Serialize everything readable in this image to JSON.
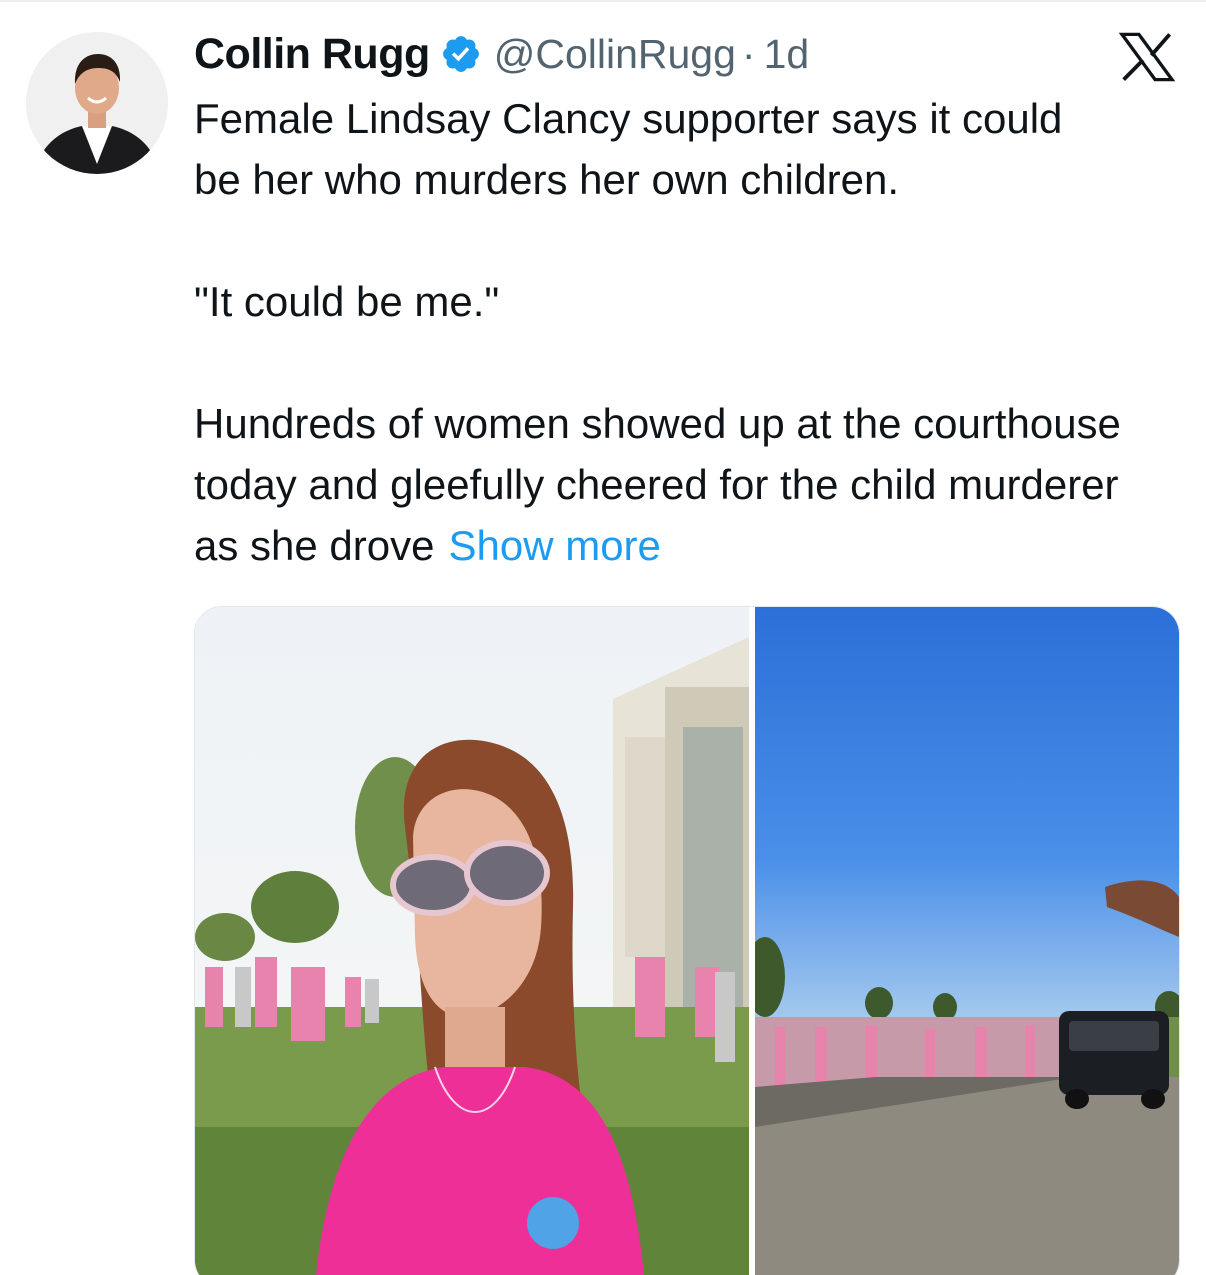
{
  "author": {
    "display_name": "Collin Rugg",
    "handle": "@CollinRugg",
    "separator": "·",
    "time": "1d",
    "verified_color": "#1d9bf0"
  },
  "tweet": {
    "paragraph_1": "Female Lindsay Clancy supporter says it could be her who murders her own children.",
    "paragraph_2": "\"It could be me.\"",
    "paragraph_3": "Hundreds of women showed up at the courthouse today and gleefully cheered for the child murderer as she drove",
    "show_more": "Show more"
  },
  "icons": {
    "verified": "verified-badge-icon",
    "platform": "x-logo-icon"
  },
  "colors": {
    "text": "#0f1419",
    "secondary": "#536471",
    "link": "#1d9bf0",
    "shirt_pink": "#ee2f98",
    "sky_blue": "#2c6fd8"
  }
}
